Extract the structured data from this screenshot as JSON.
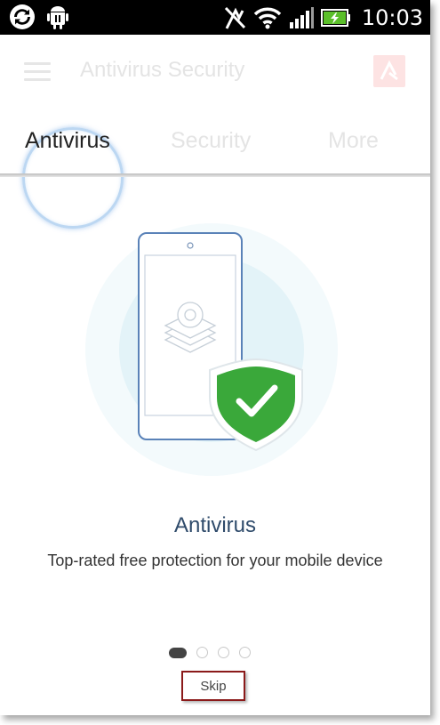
{
  "status_bar": {
    "time": "10:03",
    "icons": [
      "sync-icon",
      "android-debug-icon",
      "nfc-off-icon",
      "wifi-icon",
      "signal-icon",
      "battery-charging-icon"
    ]
  },
  "app_bar": {
    "title": "Antivirus Security",
    "menu_icon": "hamburger-menu-icon",
    "logo_icon": "avira-logo-icon"
  },
  "tabs": [
    {
      "label": "Antivirus",
      "active": true
    },
    {
      "label": "Security",
      "active": false
    },
    {
      "label": "More",
      "active": false
    }
  ],
  "onboarding": {
    "headline": "Antivirus",
    "description": "Top-rated free protection for your mobile device",
    "illustration": "phone-with-shield-check-icon",
    "page_index": 1,
    "page_count": 4
  },
  "skip_label": "Skip",
  "colors": {
    "shield_green": "#3aa83a",
    "headline": "#2f4b6b",
    "skip_border": "#8b1a1a"
  }
}
